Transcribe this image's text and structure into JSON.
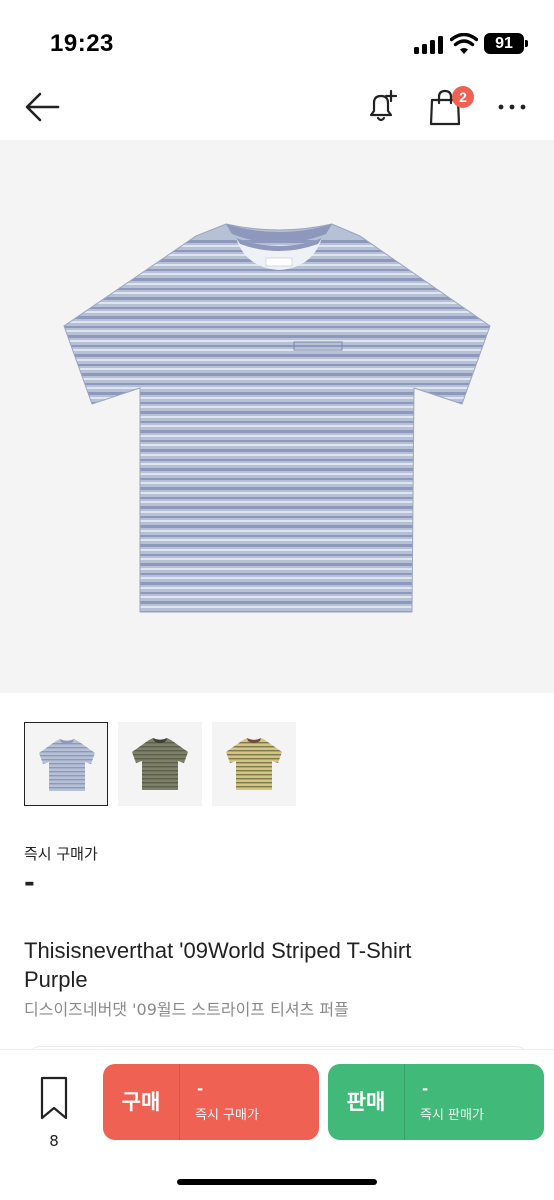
{
  "status_bar": {
    "time": "19:23",
    "battery": "91"
  },
  "header": {
    "icons": {
      "back": "arrow-left-icon",
      "notify": "bell-plus-icon",
      "cart": "shopping-bag-icon",
      "more": "more-horizontal-icon"
    },
    "cart_badge": "2"
  },
  "product_image": {
    "selected_variant": "purple",
    "colors": {
      "background": "#f4f4f4",
      "shirt_base": "#b6c1d5",
      "stripe_dark": "#8d98bc",
      "stripe_light": "#dfe5ef"
    }
  },
  "thumbnails": [
    {
      "variant": "purple",
      "selected": true,
      "colors": {
        "base": "#b6c1d5",
        "stripe": "#8d98bc",
        "collar": "#8d98bc"
      }
    },
    {
      "variant": "olive",
      "selected": false,
      "colors": {
        "base": "#7d8067",
        "stripe": "#5c604a",
        "collar": "#3c3f31"
      }
    },
    {
      "variant": "yellow",
      "selected": false,
      "colors": {
        "base": "#d8c477",
        "stripe": "#7b7a58",
        "collar": "#6d4a3a"
      }
    }
  ],
  "price": {
    "label": "즉시 구매가",
    "value": "-"
  },
  "product": {
    "name_en": "Thisisneverthat '09World Striped T-Shirt Purple",
    "name_ko": "디스이즈네버댓 '09월드 스트라이프 티셔츠 퍼플"
  },
  "bottom_bar": {
    "wishlist_icon": "bookmark-icon",
    "wishlist_count": "8",
    "buy": {
      "label": "구매",
      "price": "-",
      "sub": "즉시 구매가",
      "color": "#ef6253"
    },
    "sell": {
      "label": "판매",
      "price": "-",
      "sub": "즉시 판매가",
      "color": "#41b979"
    }
  }
}
